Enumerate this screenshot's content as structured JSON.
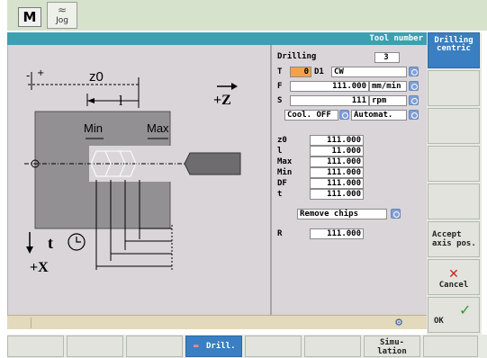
{
  "header": {
    "mode_label": "M",
    "jog_label": "Jog"
  },
  "title": {
    "right_label": "Tool number"
  },
  "graphic": {
    "z0": "z0",
    "l": "l",
    "min": "Min",
    "max": "Max",
    "z_axis": "+Z",
    "x_axis": "+X",
    "t_label": "t",
    "minus": "-",
    "plus": "+"
  },
  "panel": {
    "cycle_name": "Drilling",
    "cycle_num": "3",
    "T_label": "T",
    "T_value": "0",
    "D_label": "D1",
    "dir_value": "CW",
    "F_label": "F",
    "F_value": "111.000",
    "F_unit": "mm/min",
    "S_label": "S",
    "S_value": "111",
    "S_unit": "rpm",
    "coolant": "Cool. OFF",
    "automat": "Automat.",
    "params": [
      {
        "label": "z0",
        "value": "111.000"
      },
      {
        "label": "l",
        "value": "11.000"
      },
      {
        "label": "Max",
        "value": "111.000"
      },
      {
        "label": "Min",
        "value": "111.000"
      },
      {
        "label": "DF",
        "value": "111.000"
      },
      {
        "label": "t",
        "value": "111.000"
      }
    ],
    "chip_mode": "Remove chips",
    "R_label": "R",
    "R_value": "111.000"
  },
  "vkeys": {
    "drilling_centric_1": "Drilling",
    "drilling_centric_2": "centric",
    "accept_1": "Accept",
    "accept_2": "axis pos.",
    "cancel": "Cancel",
    "ok": "OK"
  },
  "hkeys": {
    "drill": "Drill.",
    "sim_1": "Simu-",
    "sim_2": "lation"
  },
  "colors": {
    "title_bar": "#3ba0b0",
    "active_key": "#3a7fc1",
    "orange_field": "#f3a24a",
    "cancel_x": "#d11f1f",
    "ok_check": "#2f9a2f"
  }
}
